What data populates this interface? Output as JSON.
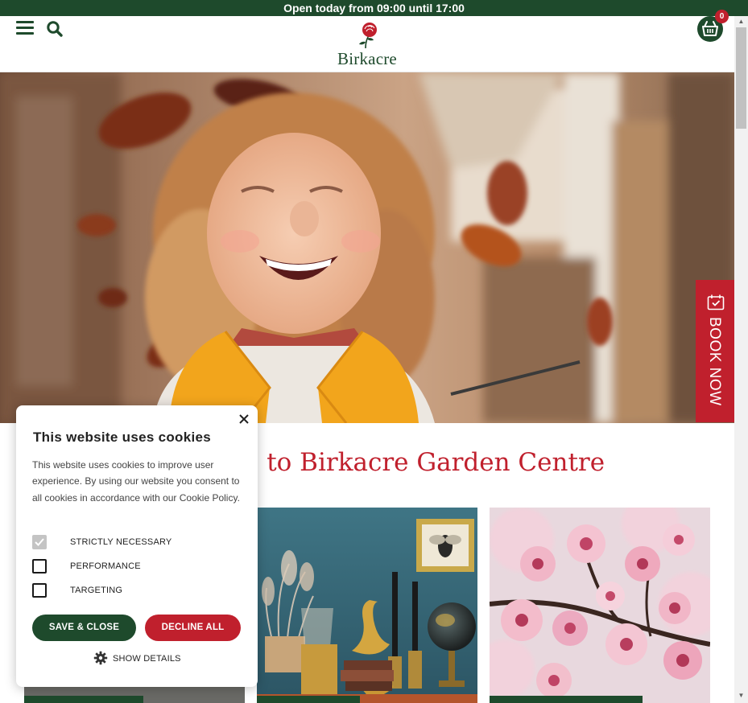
{
  "topbar": {
    "text": "Open today from 09:00 until 17:00"
  },
  "header": {
    "logo_text": "Birkacre",
    "basket_count": "0"
  },
  "book_now": {
    "label": "BOOK NOW"
  },
  "main": {
    "welcome_partial": "e to Birkacre Garden Centre"
  },
  "cookie": {
    "title": "This website uses cookies",
    "body": "This website uses cookies to improve user experience. By using our website you consent to all cookies in accordance with our Cookie Policy.",
    "options": [
      {
        "label": "STRICTLY NECESSARY",
        "checked": true
      },
      {
        "label": "PERFORMANCE",
        "checked": false
      },
      {
        "label": "TARGETING",
        "checked": false
      }
    ],
    "save_label": "SAVE & CLOSE",
    "decline_label": "DECLINE ALL",
    "details_label": "SHOW DETAILS"
  },
  "colors": {
    "brand_green": "#1e4a2c",
    "brand_red": "#c0202d"
  },
  "icons": [
    "hamburger-icon",
    "search-icon",
    "rose-logo-icon",
    "basket-icon",
    "calendar-icon",
    "close-icon",
    "gear-icon"
  ]
}
